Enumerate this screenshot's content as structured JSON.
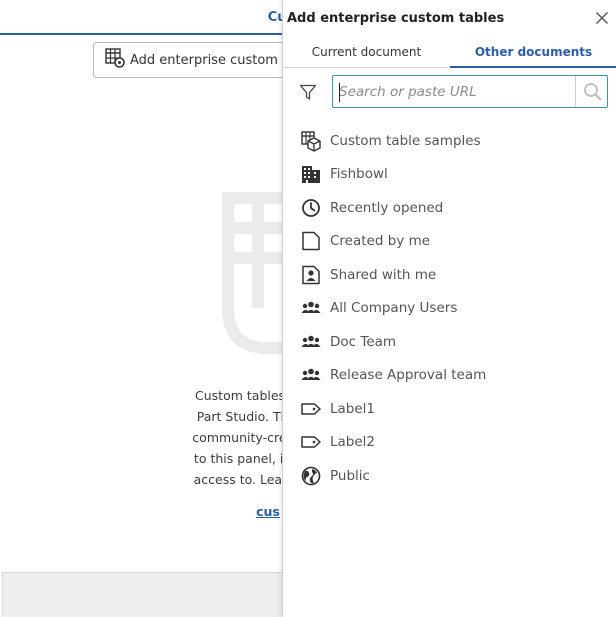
{
  "background": {
    "title": "Cus",
    "add_button_label": "Add enterprise custom",
    "description_lines": [
      "Custom tables allow you to",
      "Part Studio. They are defin",
      "community-created tables c",
      "to this panel, it will be avail",
      "access to. Learn more abou"
    ],
    "description_link": "cus"
  },
  "dialog": {
    "title": "Add enterprise custom tables",
    "tabs": [
      {
        "label": "Current document",
        "active": false
      },
      {
        "label": "Other documents",
        "active": true
      }
    ],
    "search": {
      "placeholder": "Search or paste URL",
      "value": ""
    },
    "nav_items": [
      {
        "label": "Custom table samples",
        "icon": "custom-table-samples-icon"
      },
      {
        "label": "Fishbowl",
        "icon": "building-icon"
      },
      {
        "label": "Recently opened",
        "icon": "clock-icon"
      },
      {
        "label": "Created by me",
        "icon": "document-icon"
      },
      {
        "label": "Shared with me",
        "icon": "shared-user-icon"
      },
      {
        "label": "All Company Users",
        "icon": "team-icon"
      },
      {
        "label": "Doc Team",
        "icon": "team-icon"
      },
      {
        "label": "Release Approval team",
        "icon": "team-icon"
      },
      {
        "label": "Label1",
        "icon": "label-tag-icon"
      },
      {
        "label": "Label2",
        "icon": "label-tag-icon"
      },
      {
        "label": "Public",
        "icon": "globe-icon"
      }
    ]
  },
  "colors": {
    "accent": "#2b5ea7",
    "search_border": "#3d8fb5",
    "icon": "#333333"
  }
}
